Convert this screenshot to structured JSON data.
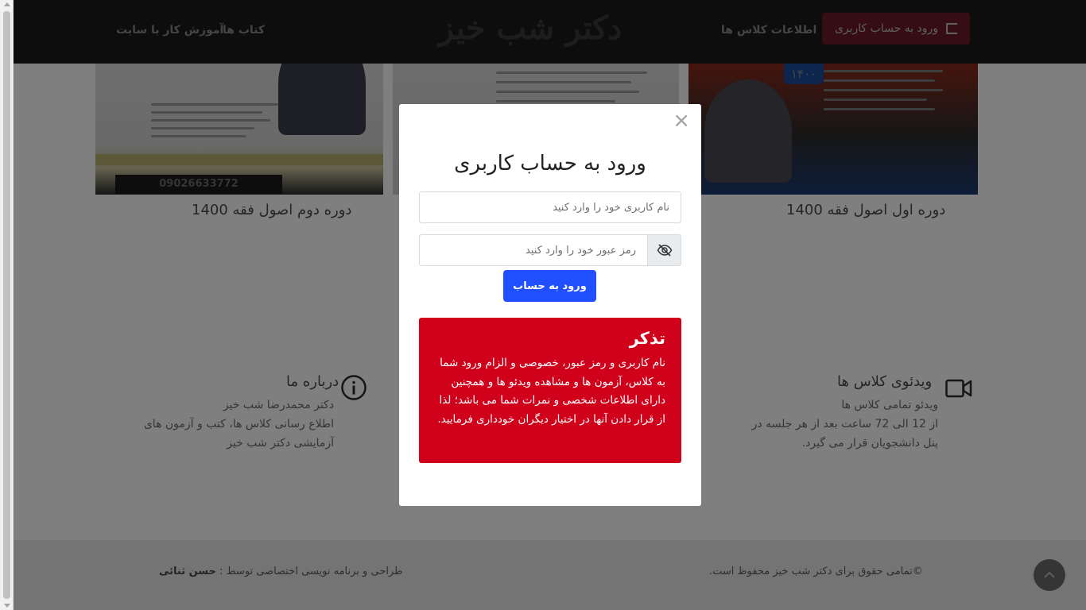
{
  "header": {
    "brand": "دکتر شب خیز",
    "nav": {
      "books": "کتاب ها",
      "tutorial": "آموزش کار با سایت",
      "class_info": "اطلاعات کلاس ها"
    },
    "login_button": "ورود به حساب کاربری"
  },
  "courses": [
    {
      "title": "دوره دوم اصول فقه 1400",
      "phone": "09026633772"
    },
    {
      "title": ""
    },
    {
      "title": "دوره اول اصول فقه 1400",
      "badge": "۱۴۰۰"
    }
  ],
  "features": {
    "about": {
      "title": "درباره ما",
      "line1": "دکتر محمدرضا شب خیز",
      "line2": "اطلاع رسانی کلاس ها، کتب و آزمون های آزمایشی دکتر شب خیز"
    },
    "videos": {
      "title": "ویدئوی کلاس ها",
      "line1": "ویدئو تمامی کلاس ها",
      "line2": "از 12 الی 72 ساعت بعد از هر جلسه در پنل دانشجویان قرار می گیرد."
    }
  },
  "footer": {
    "copyright": "©تمامی حقوق برای دکتر شب خیز محفوظ است.",
    "credit_prefix": "طراحی و برنامه نویسی اختصاصی توسط : ",
    "credit_name": "حسن ثنائی",
    "to_top_icon": "chevron-up-icon"
  },
  "modal": {
    "close": "×",
    "title": "ورود به حساب کاربری",
    "username_placeholder": "نام کاربری خود را وارد کنید",
    "password_placeholder": "رمز عبور خود را وارد کنید",
    "toggle_icon": "eye-slash-icon",
    "submit": "ورود به حساب",
    "notice": {
      "title": "تذکر",
      "text": "نام کاربری و رمز عبور، خصوصی و الزام ورود شما به کلاس، آزمون ها و مشاهده ویدئو ها و همچنین دارای اطلاعات شخصی و نمرات شما می باشد؛ لذا از قرار دادن آنها در اختیار دیگران خودداری فرمایید."
    }
  },
  "colors": {
    "header_bg": "#1b1b1b",
    "login_btn": "#d0021b",
    "submit_btn": "#1f4fff",
    "notice_bg": "#d0021b"
  }
}
